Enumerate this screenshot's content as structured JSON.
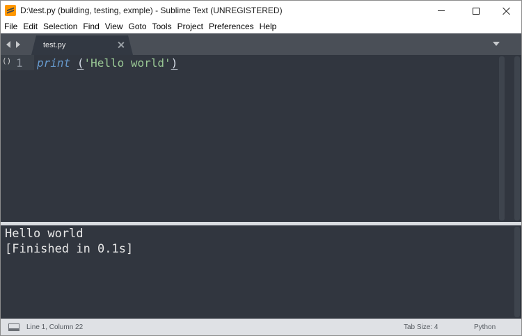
{
  "window": {
    "title": "D:\\test.py (building, testing, exmple) - Sublime Text (UNREGISTERED)"
  },
  "menu": {
    "items": [
      "File",
      "Edit",
      "Selection",
      "Find",
      "View",
      "Goto",
      "Tools",
      "Project",
      "Preferences",
      "Help"
    ]
  },
  "tabs": [
    {
      "label": "test.py",
      "active": true
    }
  ],
  "editor": {
    "gutter_marker": "()",
    "line_number": "1",
    "code": {
      "keyword": "print",
      "space": " ",
      "open_paren": "(",
      "string": "'Hello world'",
      "close_paren": ")"
    }
  },
  "output": {
    "lines": [
      "Hello world",
      "[Finished in 0.1s]"
    ]
  },
  "status": {
    "position": "Line 1, Column 22",
    "tab_size": "Tab Size: 4",
    "syntax": "Python"
  },
  "colors": {
    "editor_bg": "#31363f",
    "tabbar_bg": "#4a4f57",
    "keyword": "#6699cc",
    "string": "#99c794"
  },
  "icons": {
    "app": "sublime-text-icon",
    "nav_left": "tab-nav-left-icon",
    "nav_right": "tab-nav-right-icon",
    "tab_close": "close-icon",
    "tab_dropdown": "chevron-down-icon",
    "panel": "show-panel-icon"
  }
}
